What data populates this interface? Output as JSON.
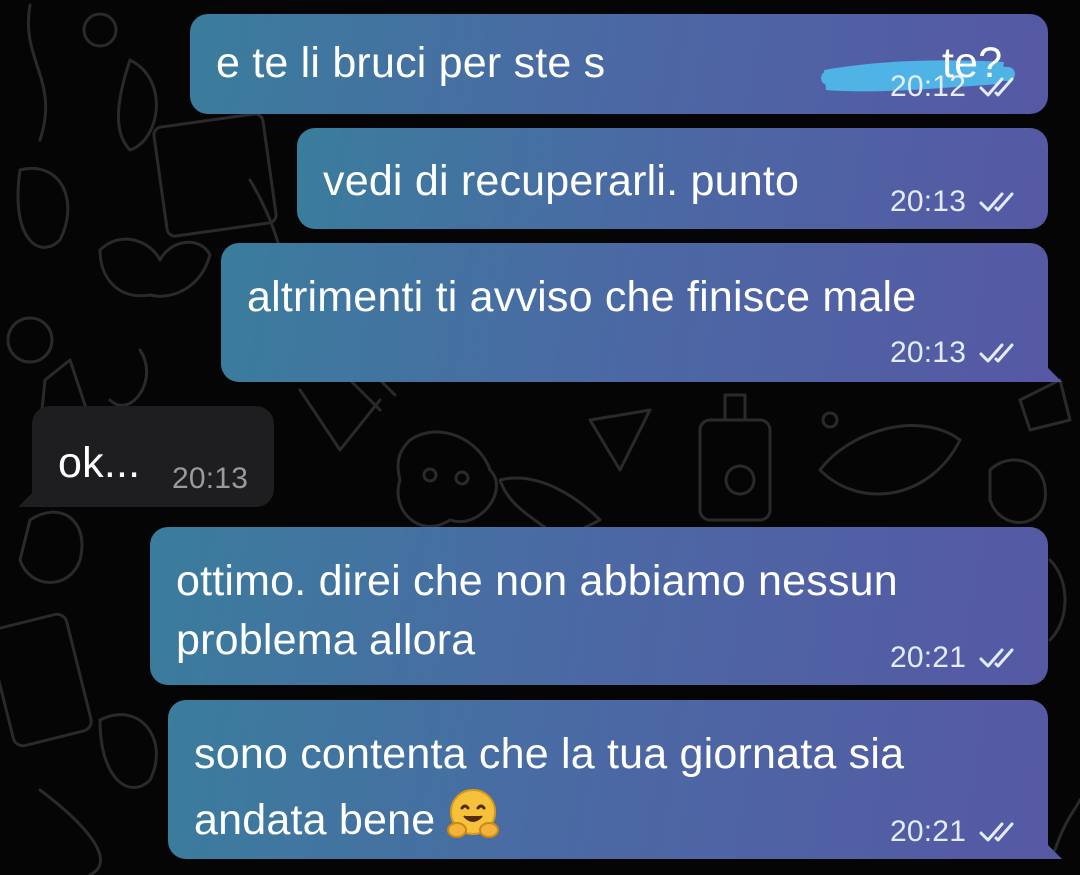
{
  "theme": {
    "outgoing_gradient": [
      "#3a7d9c",
      "#4a6aa4",
      "#5658a4"
    ],
    "incoming_bg": "#1e1e20",
    "background": "#050505",
    "redaction_color": "#4fb3e6"
  },
  "messages": [
    {
      "direction": "outgoing",
      "lines": [
        "e te li bruci per ste s",
        "te?"
      ],
      "redacted": true,
      "time": "20:12",
      "status_icon": "double-check-icon"
    },
    {
      "direction": "outgoing",
      "lines": [
        "vedi di recuperarli. punto"
      ],
      "time": "20:13",
      "status_icon": "double-check-icon"
    },
    {
      "direction": "outgoing",
      "lines": [
        "altrimenti ti avviso che finisce male"
      ],
      "time": "20:13",
      "status_icon": "double-check-icon"
    },
    {
      "direction": "incoming",
      "lines": [
        "ok..."
      ],
      "time": "20:13"
    },
    {
      "direction": "outgoing",
      "lines": [
        "ottimo. direi che non abbiamo nessun",
        "problema allora"
      ],
      "time": "20:21",
      "status_icon": "double-check-icon"
    },
    {
      "direction": "outgoing",
      "lines": [
        "sono contenta che la tua giornata sia",
        "andata bene"
      ],
      "emoji": "hugging-face-emoji",
      "time": "20:21",
      "status_icon": "double-check-icon"
    }
  ]
}
